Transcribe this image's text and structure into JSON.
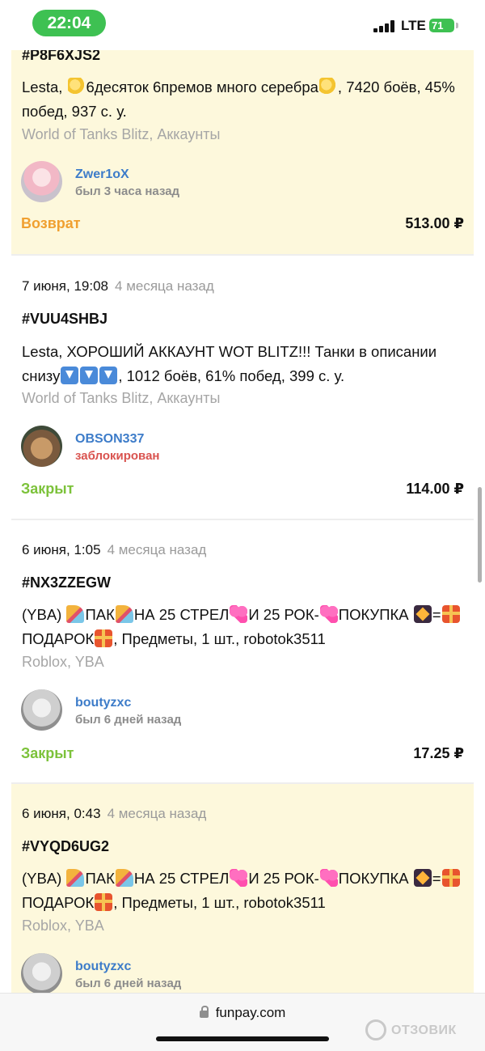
{
  "status_bar": {
    "time": "22:04",
    "network": "LTE",
    "battery": "71"
  },
  "orders": [
    {
      "order_id": "#P8F6XJS2",
      "desc_parts": [
        "Lesta, ",
        "6десяток 6премов много серебра",
        ", 7420 боёв, 45% побед, 937 с. у."
      ],
      "category": "World of Tanks Blitz, Аккаунты",
      "user": {
        "name": "Zwer1oX",
        "online": "был 3 часа назад"
      },
      "status": "Возврат",
      "status_color": "#f0a030",
      "price": "513.00 ₽"
    },
    {
      "date": "7 июня, 19:08",
      "ago": "4 месяца назад",
      "order_id": "#VUU4SHBJ",
      "desc_parts": [
        "Lesta, ХОРОШИЙ АККАУНТ WOT BLITZ!!! Танки в описании снизу",
        ", 1012 боёв, 61% побед, 399 с. у."
      ],
      "category": "World of Tanks Blitz, Аккаунты",
      "user": {
        "name": "OBSON337",
        "online": "заблокирован"
      },
      "status": "Закрыт",
      "status_color": "#7cc23a",
      "price": "114.00 ₽"
    },
    {
      "date": "6 июня, 1:05",
      "ago": "4 месяца назад",
      "order_id": "#NX3ZZEGW",
      "desc_parts": [
        "(YBA) ",
        "ПАК",
        "НА 25 СТРЕЛ",
        "И 25 РОК-",
        "ПОКУПКА ",
        "=",
        "ПОДАРОК",
        ", Предметы, 1 шт., robotok3511"
      ],
      "category": "Roblox, YBA",
      "user": {
        "name": "boutyzxc",
        "online": "был 6 дней назад"
      },
      "status": "Закрыт",
      "status_color": "#7cc23a",
      "price": "17.25 ₽"
    },
    {
      "date": "6 июня, 0:43",
      "ago": "4 месяца назад",
      "order_id": "#VYQD6UG2",
      "desc_parts": [
        "(YBA) ",
        "ПАК",
        "НА 25 СТРЕЛ",
        "И 25 РОК-",
        "ПОКУПКА ",
        "=",
        "ПОДАРОК",
        ", Предметы, 1 шт., robotok3511"
      ],
      "category": "Roblox, YBA",
      "user": {
        "name": "boutyzxc",
        "online": "был 6 дней назад"
      }
    }
  ],
  "browser": {
    "url": "funpay.com"
  },
  "watermark": "ОТЗОВИК",
  "icons": [
    "lock-icon",
    "dizzy-emoji-icon",
    "down-arrow-emoji-icon",
    "party-popper-emoji-icon",
    "heart-emoji-icon",
    "sparkler-emoji-icon",
    "gift-emoji-icon"
  ]
}
